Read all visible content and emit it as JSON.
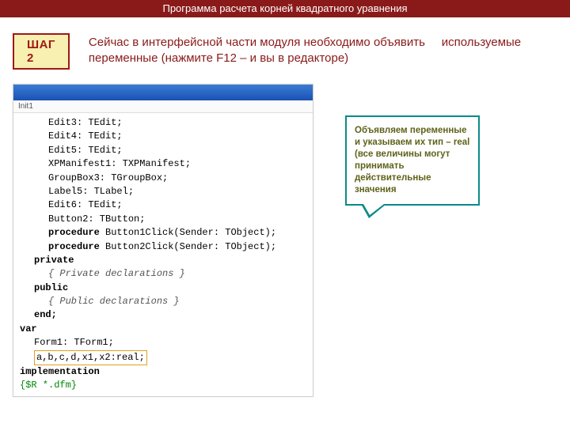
{
  "title": "Программа расчета корней квадратного уравнения",
  "step": {
    "badge": "ШАГ 2",
    "text": "Сейчас в интерфейсной части модуля необходимо объявить\n    используемые переменные (нажмите F12 – и вы в редакторе)"
  },
  "ide": {
    "tab": "Init1",
    "lines": [
      {
        "text": "Edit3: TEdit;",
        "cls": "ind2"
      },
      {
        "text": "Edit4: TEdit;",
        "cls": "ind2"
      },
      {
        "text": "Edit5: TEdit;",
        "cls": "ind2"
      },
      {
        "text": "XPManifest1: TXPManifest;",
        "cls": "ind2"
      },
      {
        "text": "GroupBox3: TGroupBox;",
        "cls": "ind2"
      },
      {
        "text": "Label5: TLabel;",
        "cls": "ind2"
      },
      {
        "text": "Edit6: TEdit;",
        "cls": "ind2"
      },
      {
        "text": "Button2: TButton;",
        "cls": "ind2"
      },
      {
        "pre": "procedure",
        "text": " Button1Click(Sender: TObject);",
        "cls": "ind2",
        "kw": true
      },
      {
        "pre": "procedure",
        "text": " Button2Click(Sender: TObject);",
        "cls": "ind2",
        "kw": true
      },
      {
        "text": "private",
        "cls": "ind1",
        "kw_all": true
      },
      {
        "text": "{ Private declarations }",
        "cls": "ind2",
        "cmt": true
      },
      {
        "text": "public",
        "cls": "ind1",
        "kw_all": true
      },
      {
        "text": "{ Public declarations }",
        "cls": "ind2",
        "cmt": true
      },
      {
        "text": "end;",
        "cls": "ind1",
        "kw_all": true
      },
      {
        "text": "",
        "cls": ""
      },
      {
        "text": "var",
        "cls": "",
        "kw_all": true
      },
      {
        "text": "Form1: TForm1;",
        "cls": "ind1"
      },
      {
        "text": "a,b,c,d,x1,x2:real;",
        "cls": "ind1",
        "hl": true
      },
      {
        "text": "implementation",
        "cls": "",
        "kw_all": true
      },
      {
        "text": "",
        "cls": ""
      },
      {
        "text": "{$R *.dfm}",
        "cls": "",
        "directive": true
      }
    ]
  },
  "callout": {
    "text": " Объявляем переменные и указываем их тип – real (все величины могут принимать действительные значения"
  }
}
